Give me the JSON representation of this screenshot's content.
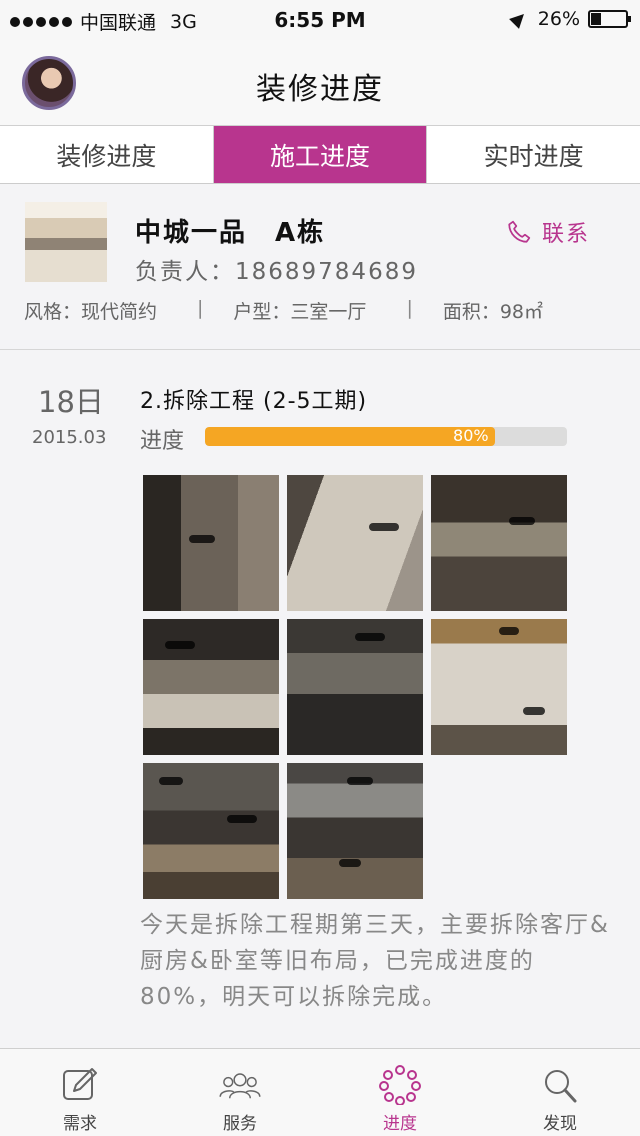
{
  "status_bar": {
    "carrier": "中国联通",
    "network": "3G",
    "time": "6:55 PM",
    "battery": "26%"
  },
  "header": {
    "title": "装修进度"
  },
  "tabs": [
    {
      "label": "装修进度",
      "active": false
    },
    {
      "label": "施工进度",
      "active": true
    },
    {
      "label": "实时进度",
      "active": false
    }
  ],
  "project": {
    "name": "中城一品　A栋",
    "manager": "负责人：18689784689",
    "contact_label": "联系",
    "style": "风格：现代简约",
    "layout": "户型：三室一厅",
    "area": "面积：98㎡"
  },
  "timeline": {
    "day": "18日",
    "month": "2015.03",
    "step_title": "2.拆除工程 (2-5工期)",
    "progress_label": "进度",
    "progress_value": 0.8,
    "progress_text": "80%",
    "photo_count": 8,
    "description": "今天是拆除工程期第三天，主要拆除客厅&厨房&卧室等旧布局，已完成进度的80%，明天可以拆除完成。"
  },
  "bottom_nav": [
    {
      "label": "需求",
      "icon": "edit-icon",
      "active": false
    },
    {
      "label": "服务",
      "icon": "people-icon",
      "active": false
    },
    {
      "label": "进度",
      "icon": "progress-ring-icon",
      "active": true
    },
    {
      "label": "发现",
      "icon": "search-icon",
      "active": false
    }
  ],
  "colors": {
    "accent": "#b8358e",
    "progress": "#f5a623"
  }
}
